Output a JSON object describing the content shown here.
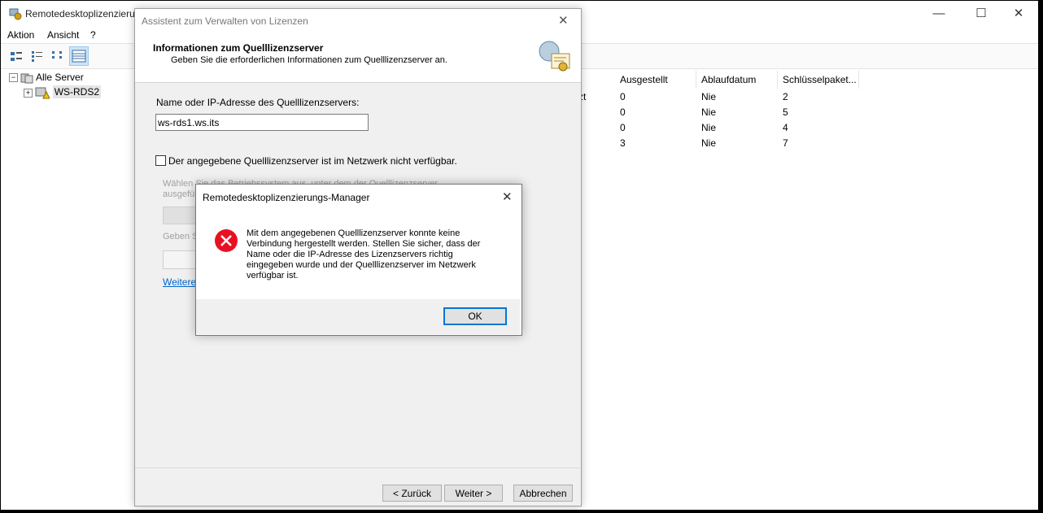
{
  "main_window": {
    "title": "Remotedesktoplizenzierungs-Manager",
    "menu": [
      "Aktion",
      "Ansicht",
      "?"
    ],
    "tree": {
      "root": "Alle Server",
      "child": "WS-RDS2"
    },
    "columns": [
      "Ausgestellt",
      "Ablaufdatum",
      "Schlüsselpaket..."
    ],
    "partial_cell": "zt",
    "rows": [
      {
        "ausgestellt": "0",
        "ablaufdatum": "Nie",
        "schluessel": "2"
      },
      {
        "ausgestellt": "0",
        "ablaufdatum": "Nie",
        "schluessel": "5"
      },
      {
        "ausgestellt": "0",
        "ablaufdatum": "Nie",
        "schluessel": "4"
      },
      {
        "ausgestellt": "3",
        "ablaufdatum": "Nie",
        "schluessel": "7"
      }
    ]
  },
  "wizard": {
    "title": "Assistent zum Verwalten von Lizenzen",
    "header_title": "Informationen zum Quelllizenzserver",
    "header_subtitle": "Geben Sie die erforderlichen Informationen zum Quelllizenzserver an.",
    "name_label": "Name oder IP-Adresse des Quelllizenzservers:",
    "name_value": "ws-rds1.ws.its",
    "checkbox_label": "Der angegebene Quelllizenzserver ist im Netzwerk nicht verfügbar.",
    "checkbox_checked": false,
    "disabled_text_line1": "Wählen Sie das Betriebssystem aus, unter dem der Quelllizenzserver",
    "disabled_text_line2": "ausgeführ",
    "disabled_label2": "Geben S",
    "link_text": "Weitere",
    "btn_back": "< Zurück",
    "btn_next": "Weiter >",
    "btn_cancel": "Abbrechen"
  },
  "msgbox": {
    "title": "Remotedesktoplizenzierungs-Manager",
    "message_lines": [
      "Mit dem angegebenen Quelllizenzserver konnte keine",
      "Verbindung hergestellt werden. Stellen Sie sicher, dass der",
      "Name oder die IP-Adresse des Lizenzservers richtig",
      "eingegeben wurde und der Quelllizenzserver im Netzwerk",
      "verfügbar ist."
    ],
    "ok_label": "OK",
    "icon": "error-icon"
  },
  "colors": {
    "accent": "#0078d7",
    "error": "#e81123",
    "link": "#0066cc"
  }
}
